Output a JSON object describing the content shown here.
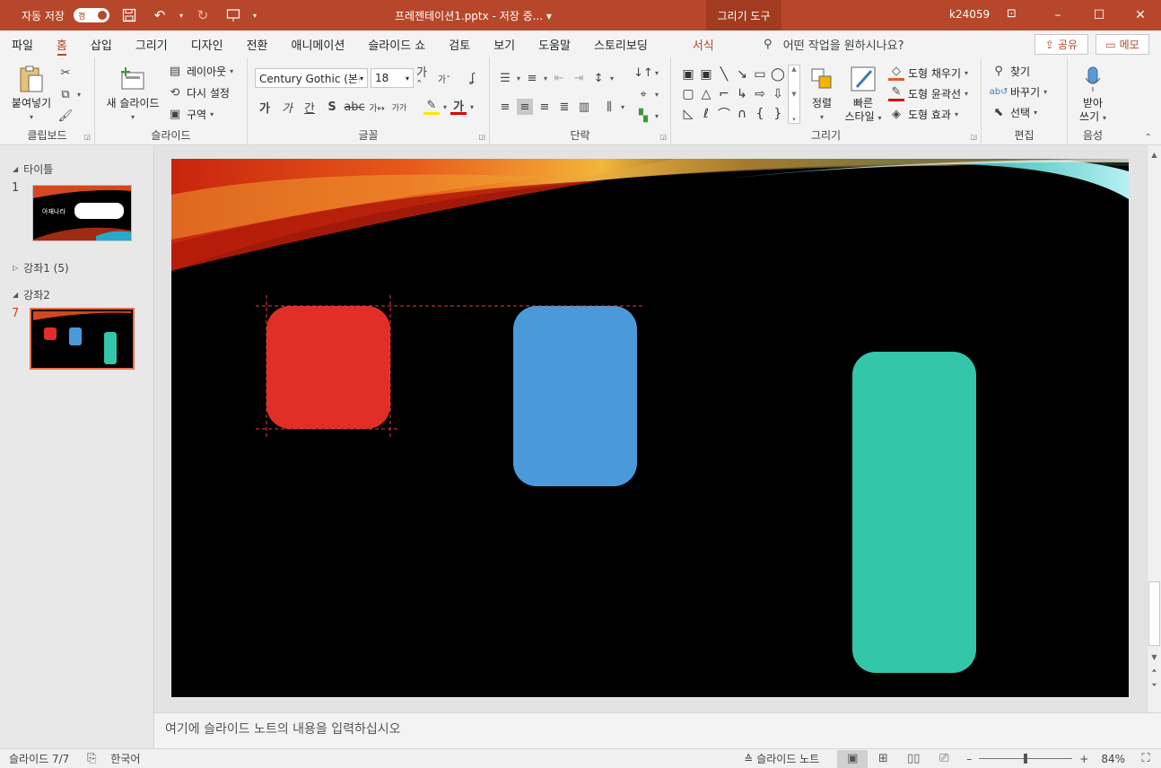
{
  "titlebar": {
    "autosave_label": "자동 저장",
    "autosave_state": "켬",
    "document_title": "프레젠테이션1.pptx - 저장 중... ▾",
    "context_tab": "그리기 도구",
    "user": "k24059",
    "minimize": "–",
    "maximize": "☐",
    "close": "✕"
  },
  "tabs": {
    "items": [
      "파일",
      "홈",
      "삽입",
      "그리기",
      "디자인",
      "전환",
      "애니메이션",
      "슬라이드 쇼",
      "검토",
      "보기",
      "도움말",
      "스토리보딩"
    ],
    "active_index": 1,
    "format": "서식",
    "search_placeholder": "어떤 작업을 원하시나요?",
    "share": "공유",
    "memo": "메모"
  },
  "ribbon": {
    "clipboard": {
      "label": "클립보드",
      "paste": "붙여넣기"
    },
    "slides": {
      "label": "슬라이드",
      "new_slide": "새 슬라이드",
      "layout": "레이아웃",
      "reset": "다시 설정",
      "section": "구역"
    },
    "font": {
      "label": "글꼴",
      "font_name": "Century Gothic (본문",
      "font_size": "18"
    },
    "paragraph": {
      "label": "단락"
    },
    "drawing": {
      "label": "그리기",
      "arrange": "정렬",
      "quick_styles_1": "빠른",
      "quick_styles_2": "스타일",
      "fill": "도형 채우기",
      "outline": "도형 윤곽선",
      "effects": "도형 효과"
    },
    "editing": {
      "label": "편집",
      "find": "찾기",
      "replace": "바꾸기",
      "select": "선택"
    },
    "voice": {
      "label": "음성",
      "dictate_1": "받아",
      "dictate_2": "쓰기"
    }
  },
  "slides_panel": {
    "section_title": "타이틀",
    "section_lecture1": "강좌1 (5)",
    "section_lecture2": "강좌2",
    "slide1_num": "1",
    "slide7_num": "7",
    "thumb1_text": "아재나라"
  },
  "slide": {
    "shapes": [
      {
        "name": "red",
        "color": "#e12f27"
      },
      {
        "name": "blue",
        "color": "#4a9ada"
      },
      {
        "name": "green",
        "color": "#33c6a8"
      }
    ]
  },
  "notes": {
    "placeholder": "여기에 슬라이드 노트의 내용을 입력하십시오"
  },
  "statusbar": {
    "slide_count": "슬라이드 7/7",
    "language": "한국어",
    "notes": "슬라이드 노트",
    "zoom": "84%"
  }
}
